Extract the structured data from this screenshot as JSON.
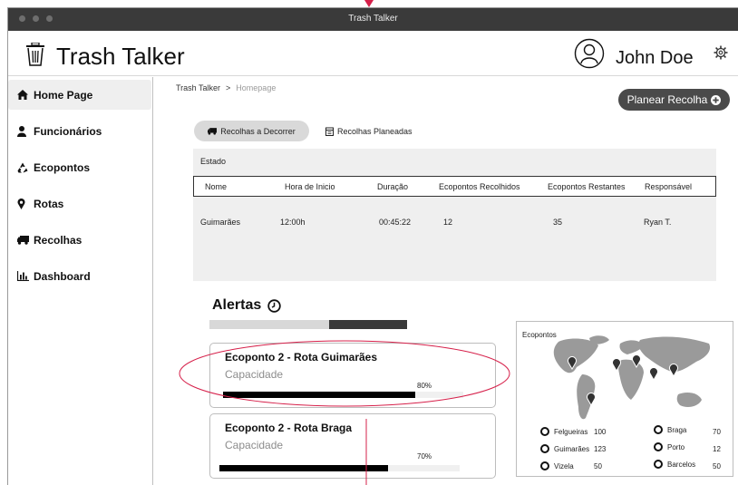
{
  "window": {
    "title": "Trash Talker"
  },
  "header": {
    "app_name": "Trash Talker",
    "user_name": "John Doe"
  },
  "sidebar": {
    "items": [
      {
        "label": "Home Page",
        "icon": "home-icon"
      },
      {
        "label": "Funcionários",
        "icon": "user-icon"
      },
      {
        "label": "Ecopontos",
        "icon": "recycle-icon"
      },
      {
        "label": "Rotas",
        "icon": "map-marker-icon"
      },
      {
        "label": "Recolhas",
        "icon": "truck-icon"
      },
      {
        "label": "Dashboard",
        "icon": "bar-chart-icon"
      }
    ]
  },
  "breadcrumb": {
    "root": "Trash Talker",
    "separator": ">",
    "current": "Homepage"
  },
  "plan_button": {
    "label": "Planear Recolha"
  },
  "tabs": [
    {
      "label": "Recolhas a Decorrer",
      "icon": "truck-icon"
    },
    {
      "label": "Recolhas Planeadas",
      "icon": "calendar-icon"
    }
  ],
  "table": {
    "state_label": "Estado",
    "columns": [
      "Nome",
      "Hora de Inicio",
      "Duração",
      "Ecopontos Recolhidos",
      "Ecopontos Restantes",
      "Responsável"
    ],
    "rows": [
      [
        "Guimarães",
        "12:00h",
        "00:45:22",
        "12",
        "35",
        "Ryan T."
      ]
    ]
  },
  "alerts": {
    "title": "Alertas",
    "cards": [
      {
        "title": "Ecoponto 2 - Rota Guimarães",
        "subtitle": "Capacidade",
        "percent_label": "80%",
        "value": 0.8
      },
      {
        "title": "Ecoponto 2 - Rota Braga",
        "subtitle": "Capacidade",
        "percent_label": "70%",
        "value": 0.7
      }
    ]
  },
  "map": {
    "title": "Ecopontos",
    "legend": [
      {
        "name": "Felgueiras",
        "value": "100"
      },
      {
        "name": "Guimarães",
        "value": "123"
      },
      {
        "name": "Vizela",
        "value": "50"
      },
      {
        "name": "Braga",
        "value": "70"
      },
      {
        "name": "Porto",
        "value": "12"
      },
      {
        "name": "Barcelos",
        "value": "50"
      }
    ]
  },
  "colors": {
    "accent_dark": "#4a4a4a",
    "annotation": "#d6204a"
  }
}
